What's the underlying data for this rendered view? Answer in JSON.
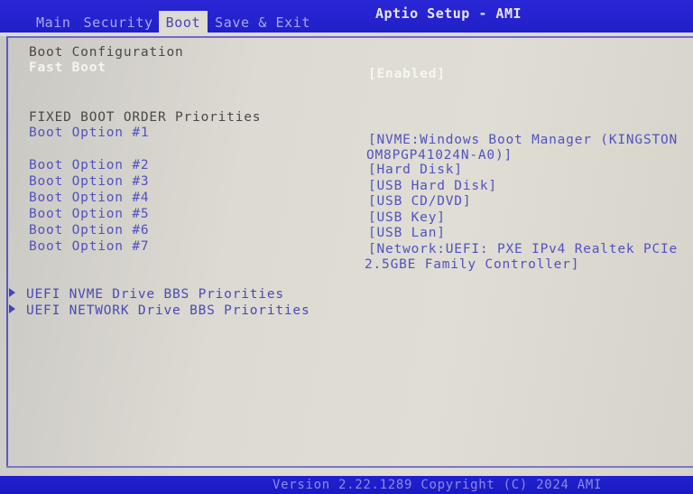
{
  "header": {
    "title": "Aptio Setup - AMI",
    "tabs": [
      {
        "label": "Main",
        "active": false
      },
      {
        "label": "Security",
        "active": false
      },
      {
        "label": "Boot",
        "active": true
      },
      {
        "label": "Save & Exit",
        "active": false
      }
    ]
  },
  "boot": {
    "section_title": "Boot Configuration",
    "fast_boot": {
      "label": "Fast Boot",
      "value": "[Enabled]"
    },
    "fixed_order_title": "FIXED BOOT ORDER Priorities",
    "options": [
      {
        "label": "Boot Option #1",
        "value_line1": "[NVME:Windows Boot Manager (KINGSTON",
        "value_line2": "OM8PGP41024N-A0)]"
      },
      {
        "label": "Boot Option #2",
        "value_line1": "[Hard Disk]"
      },
      {
        "label": "Boot Option #3",
        "value_line1": "[USB Hard Disk]"
      },
      {
        "label": "Boot Option #4",
        "value_line1": "[USB CD/DVD]"
      },
      {
        "label": "Boot Option #5",
        "value_line1": "[USB Key]"
      },
      {
        "label": "Boot Option #6",
        "value_line1": "[USB Lan]"
      },
      {
        "label": "Boot Option #7",
        "value_line1": "[Network:UEFI: PXE IPv4 Realtek PCIe",
        "value_line2": "2.5GBE Family Controller]"
      }
    ],
    "submenus": [
      {
        "label": "UEFI NVME Drive BBS Priorities",
        "icon": "triangle-right"
      },
      {
        "label": "UEFI NETWORK Drive BBS Priorities",
        "icon": "triangle-right"
      }
    ]
  },
  "footer": {
    "version": "Version 2.22.1289 Copyright (C) 2024 AMI"
  },
  "colors": {
    "bar_blue": "#2222cf",
    "option_blue": "#5252c0",
    "selected_white": "#f6f5ef",
    "background": "#dcdad2"
  }
}
